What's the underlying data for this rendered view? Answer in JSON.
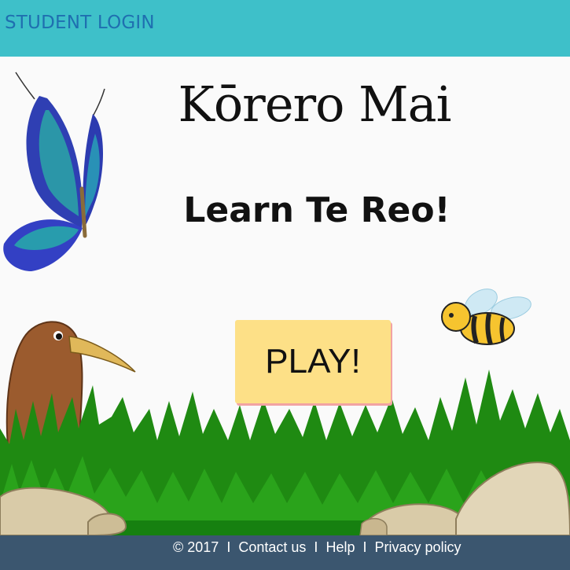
{
  "header": {
    "student_login_label": "STUDENT LOGIN"
  },
  "main": {
    "title": "Kōrero Mai",
    "subtitle": "Learn Te Reo!",
    "play_label": "PLAY!"
  },
  "footer": {
    "copyright": "© 2017",
    "separator": "I",
    "contact_label": "Contact us",
    "help_label": "Help",
    "privacy_label": "Privacy policy"
  },
  "colors": {
    "header_bg": "#3ec0c9",
    "login_text": "#1f6fb0",
    "play_bg": "#fde087",
    "footer_bg": "#3b566f"
  },
  "icons": [
    "butterfly-icon",
    "kiwi-bird-icon",
    "bee-icon",
    "grass-illustration",
    "rocks-illustration"
  ]
}
